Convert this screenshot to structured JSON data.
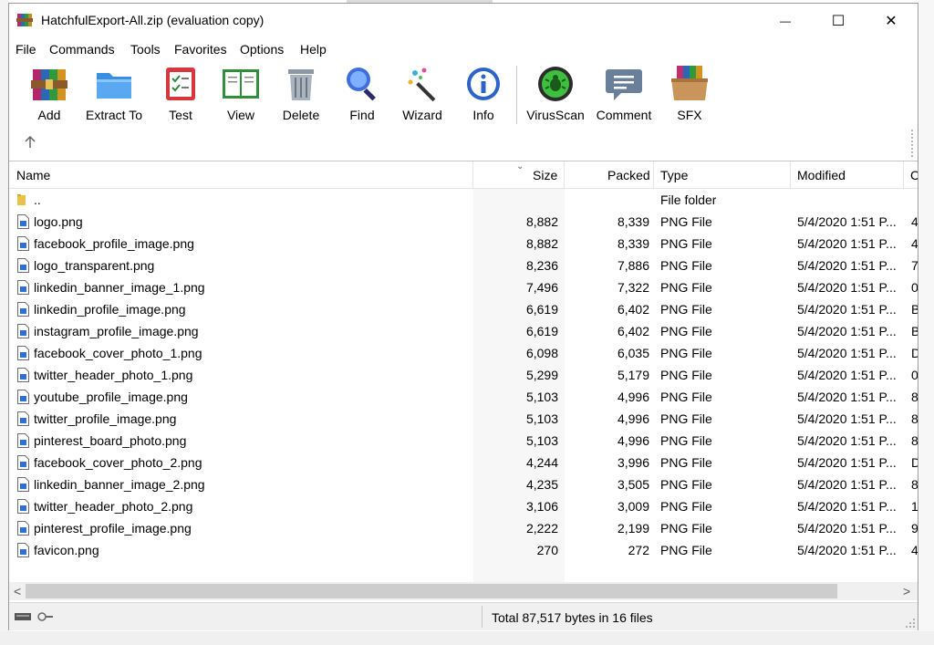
{
  "window": {
    "title": "HatchfulExport-All.zip (evaluation copy)",
    "minimize_glyph": "—",
    "maximize_glyph": "☐",
    "close_glyph": "✕"
  },
  "menu": [
    "File",
    "Commands",
    "Tools",
    "Favorites",
    "Options",
    "Help"
  ],
  "toolbar": [
    {
      "label": "Add",
      "icon": "archive-books-icon"
    },
    {
      "label": "Extract To",
      "icon": "folder-extract-icon"
    },
    {
      "label": "Test",
      "icon": "clipboard-check-icon"
    },
    {
      "label": "View",
      "icon": "open-book-icon"
    },
    {
      "label": "Delete",
      "icon": "trash-can-icon"
    },
    {
      "label": "Find",
      "icon": "magnifier-icon"
    },
    {
      "label": "Wizard",
      "icon": "magic-wand-icon"
    },
    {
      "label": "Info",
      "icon": "info-icon"
    },
    {
      "label": "VirusScan",
      "icon": "virus-scan-icon"
    },
    {
      "label": "Comment",
      "icon": "comment-bubble-icon"
    },
    {
      "label": "SFX",
      "icon": "sfx-box-icon"
    }
  ],
  "columns": {
    "name": "Name",
    "size": "Size",
    "packed": "Packed",
    "type": "Type",
    "modified": "Modified",
    "crc": "C"
  },
  "parent_row": {
    "name": "..",
    "type": "File folder"
  },
  "files": [
    {
      "name": "logo.png",
      "size": "8,882",
      "packed": "8,339",
      "type": "PNG File",
      "modified": "5/4/2020 1:51 P...",
      "crc": "4"
    },
    {
      "name": "facebook_profile_image.png",
      "size": "8,882",
      "packed": "8,339",
      "type": "PNG File",
      "modified": "5/4/2020 1:51 P...",
      "crc": "4"
    },
    {
      "name": "logo_transparent.png",
      "size": "8,236",
      "packed": "7,886",
      "type": "PNG File",
      "modified": "5/4/2020 1:51 P...",
      "crc": "7"
    },
    {
      "name": "linkedin_banner_image_1.png",
      "size": "7,496",
      "packed": "7,322",
      "type": "PNG File",
      "modified": "5/4/2020 1:51 P...",
      "crc": "0"
    },
    {
      "name": "linkedin_profile_image.png",
      "size": "6,619",
      "packed": "6,402",
      "type": "PNG File",
      "modified": "5/4/2020 1:51 P...",
      "crc": "B"
    },
    {
      "name": "instagram_profile_image.png",
      "size": "6,619",
      "packed": "6,402",
      "type": "PNG File",
      "modified": "5/4/2020 1:51 P...",
      "crc": "B"
    },
    {
      "name": "facebook_cover_photo_1.png",
      "size": "6,098",
      "packed": "6,035",
      "type": "PNG File",
      "modified": "5/4/2020 1:51 P...",
      "crc": "D"
    },
    {
      "name": "twitter_header_photo_1.png",
      "size": "5,299",
      "packed": "5,179",
      "type": "PNG File",
      "modified": "5/4/2020 1:51 P...",
      "crc": "0"
    },
    {
      "name": "youtube_profile_image.png",
      "size": "5,103",
      "packed": "4,996",
      "type": "PNG File",
      "modified": "5/4/2020 1:51 P...",
      "crc": "8"
    },
    {
      "name": "twitter_profile_image.png",
      "size": "5,103",
      "packed": "4,996",
      "type": "PNG File",
      "modified": "5/4/2020 1:51 P...",
      "crc": "8"
    },
    {
      "name": "pinterest_board_photo.png",
      "size": "5,103",
      "packed": "4,996",
      "type": "PNG File",
      "modified": "5/4/2020 1:51 P...",
      "crc": "8"
    },
    {
      "name": "facebook_cover_photo_2.png",
      "size": "4,244",
      "packed": "3,996",
      "type": "PNG File",
      "modified": "5/4/2020 1:51 P...",
      "crc": "D"
    },
    {
      "name": "linkedin_banner_image_2.png",
      "size": "4,235",
      "packed": "3,505",
      "type": "PNG File",
      "modified": "5/4/2020 1:51 P...",
      "crc": "8"
    },
    {
      "name": "twitter_header_photo_2.png",
      "size": "3,106",
      "packed": "3,009",
      "type": "PNG File",
      "modified": "5/4/2020 1:51 P...",
      "crc": "1"
    },
    {
      "name": "pinterest_profile_image.png",
      "size": "2,222",
      "packed": "2,199",
      "type": "PNG File",
      "modified": "5/4/2020 1:51 P...",
      "crc": "9"
    },
    {
      "name": "favicon.png",
      "size": "270",
      "packed": "272",
      "type": "PNG File",
      "modified": "5/4/2020 1:51 P...",
      "crc": "4"
    }
  ],
  "scroll": {
    "left": "<",
    "right": ">"
  },
  "status": {
    "total": "Total 87,517 bytes in 16 files"
  },
  "colors": {
    "accent": "#1f6fd0",
    "status_bg": "#f0f0f0",
    "size_col_bg": "#f7f7f7"
  }
}
